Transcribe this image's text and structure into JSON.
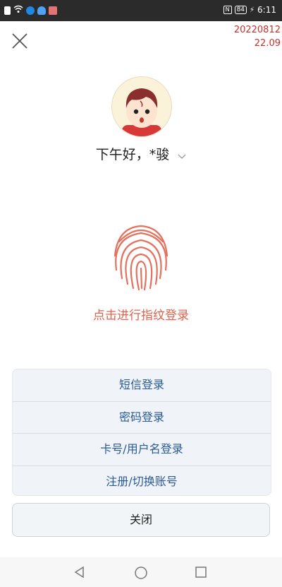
{
  "status_bar": {
    "time": "6:11",
    "battery": "84",
    "nfc": "N"
  },
  "version": {
    "line1": "20220812",
    "line2": "22.09"
  },
  "greeting": "下午好，*骏",
  "fingerprint_prompt": "点击进行指纹登录",
  "options": [
    {
      "label": "短信登录"
    },
    {
      "label": "密码登录"
    },
    {
      "label": "卡号/用户名登录"
    },
    {
      "label": "注册/切换账号"
    }
  ],
  "close_label": "关闭",
  "colors": {
    "accent_red": "#e2614d",
    "link_blue": "#2a5a96",
    "version_red": "#c8302a"
  }
}
